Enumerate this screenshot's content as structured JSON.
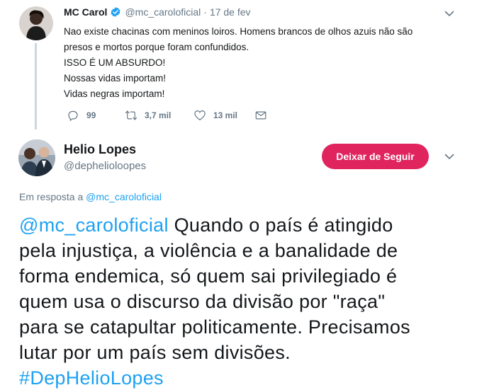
{
  "tweet1": {
    "name": "MC Carol",
    "handle": "@mc_caroloficial",
    "separator": "·",
    "time": "17 de fev",
    "lines": [
      "Nao existe chacinas com meninos loiros. Homens brancos de olhos azuis não são",
      "presos e mortos porque foram confundidos.",
      "ISSO É UM ABSURDO!",
      "Nossas vidas importam!",
      "Vidas negras importam!"
    ],
    "replies": "99",
    "retweets": "3,7 mil",
    "likes": "13 mil"
  },
  "tweet2": {
    "name": "Helio Lopes",
    "handle": "@dephelioloopes",
    "follow_label": "Deixar de Seguir",
    "reply_prefix": "Em resposta a",
    "reply_handle": "@mc_caroloficial",
    "mention": "@mc_caroloficial",
    "lines": [
      " Quando o país é atingido",
      "pela injustiça, a violência e a banalidade de",
      "forma endemica, só quem sai privilegiado é",
      "quem usa o discurso da divisão por \"raça\"",
      "para se catapultar politicamente. Precisamos",
      "lutar por um país sem divisões."
    ],
    "hashtag": "#DepHelioLopes"
  },
  "colors": {
    "link": "#1da1f2",
    "secondary_text": "#657786",
    "unfollow_button": "#e0245e",
    "thread_line": "#ccd6dd"
  },
  "icons": [
    "verified-badge-icon",
    "chevron-down-icon",
    "reply-icon",
    "retweet-icon",
    "heart-icon",
    "direct-message-icon"
  ]
}
